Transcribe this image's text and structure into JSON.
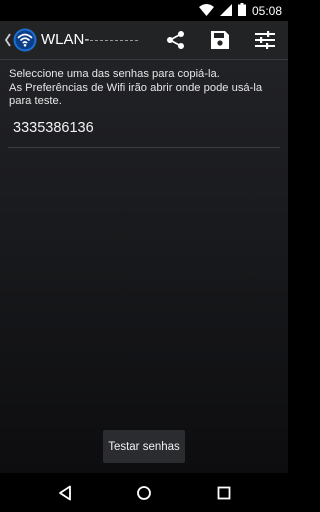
{
  "status_bar": {
    "time": "05:08",
    "icons": [
      "wifi-icon",
      "signal-icon",
      "battery-icon"
    ]
  },
  "action_bar": {
    "title": "WLAN-",
    "logo_icon": "wifi-logo-icon",
    "actions": [
      "share-icon",
      "save-icon",
      "settings-sliders-icon"
    ]
  },
  "main": {
    "instruction_line1": "Seleccione uma das senhas para copiá-la.",
    "instruction_line2": "As Preferências de Wifi irão abrir onde pode usá-la para teste.",
    "passwords": [
      "3335386136"
    ],
    "test_button_label": "Testar senhas"
  },
  "nav_bar": {
    "buttons": [
      "back-icon",
      "home-icon",
      "recents-icon"
    ]
  },
  "colors": {
    "action_bar_bg": "#222325",
    "logo_blue": "#1e6fd0",
    "text": "#e6e6e6"
  }
}
